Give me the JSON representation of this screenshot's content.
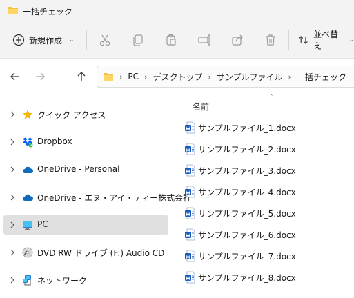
{
  "window": {
    "title": "一括チェック"
  },
  "toolbar": {
    "new_label": "新規作成",
    "new_chevron": "⌄",
    "sort_label": "並べ替え",
    "sort_chevron": "⌄",
    "icons": [
      "cut-icon",
      "copy-icon",
      "paste-icon",
      "rename-icon",
      "share-icon",
      "delete-icon"
    ]
  },
  "address": {
    "crumbs": [
      "PC",
      "デスクトップ",
      "サンプルファイル",
      "一括チェック"
    ],
    "separator": "›"
  },
  "sidebar": {
    "items": [
      {
        "label": "クイック アクセス",
        "icon": "star-icon",
        "selected": false
      },
      {
        "label": "Dropbox",
        "icon": "dropbox-icon",
        "selected": false
      },
      {
        "label": "OneDrive - Personal",
        "icon": "cloud-icon",
        "selected": false
      },
      {
        "label": "OneDrive - エヌ・アイ・ティー株式会社",
        "icon": "cloud-icon",
        "selected": false
      },
      {
        "label": "PC",
        "icon": "monitor-icon",
        "selected": true
      },
      {
        "label": "DVD RW ドライブ (F:) Audio CD",
        "icon": "disc-drive-icon",
        "selected": false
      },
      {
        "label": "ネットワーク",
        "icon": "network-icon",
        "selected": false
      }
    ]
  },
  "content": {
    "column_name": "名前",
    "sort_caret": "˄",
    "files": [
      {
        "name": "サンプルファイル_1.docx"
      },
      {
        "name": "サンプルファイル_2.docx"
      },
      {
        "name": "サンプルファイル_3.docx"
      },
      {
        "name": "サンプルファイル_4.docx"
      },
      {
        "name": "サンプルファイル_5.docx"
      },
      {
        "name": "サンプルファイル_6.docx"
      },
      {
        "name": "サンプルファイル_7.docx"
      },
      {
        "name": "サンプルファイル_8.docx"
      }
    ]
  },
  "colors": {
    "folder": "#f5c344",
    "word_blue": "#185abd",
    "onedrive": "#0f6cbd",
    "dropbox": "#0061fe",
    "star": "#f7b500",
    "selected_bg": "#e0e0e0"
  }
}
